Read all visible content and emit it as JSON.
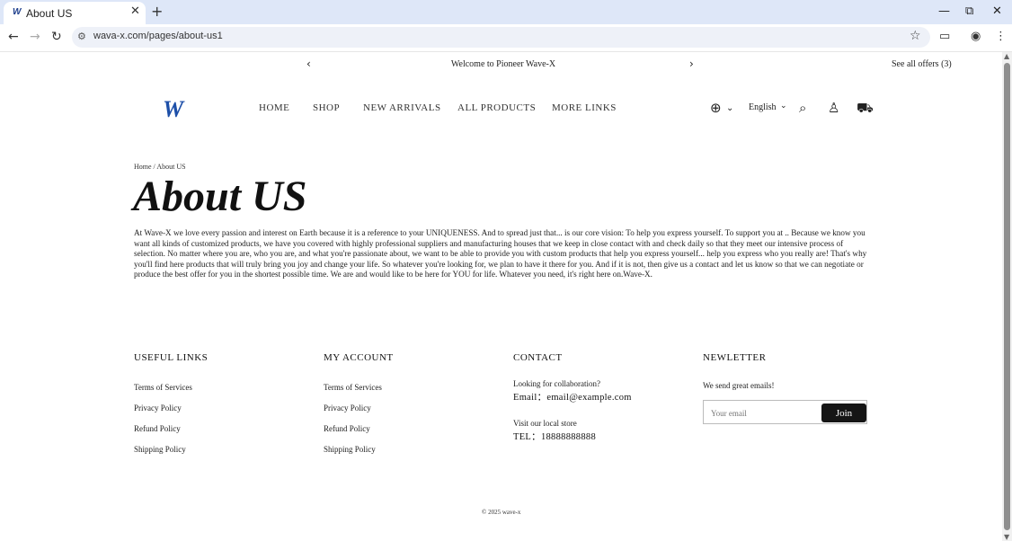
{
  "browser": {
    "tab_title": "About US",
    "tab_logo": "W",
    "url": "wava-x.com/pages/about-us1"
  },
  "announcement": {
    "text": "Welcome to  Pioneer Wave-X",
    "offers": "See all offers (3)"
  },
  "header": {
    "logo": "W",
    "nav": [
      "HOME",
      "SHOP",
      "NEW ARRIVALS",
      "ALL PRODUCTS",
      "MORE LINKS"
    ],
    "language": "English"
  },
  "page": {
    "breadcrumb": "Home / About US",
    "title": "About US",
    "body": "At Wave-X we love every passion and interest on Earth because it is a reference to your UNIQUENESS. And to spread just that... is our core vision: To help you express yourself. To support you at .. Because we know you want all kinds of customized products, we have you covered with highly professional suppliers and manufacturing houses that we keep in close contact with and check daily so that they meet our intensive process of selection. No matter where you are, who you are, and what you're passionate about, we want to be able to provide you with custom products that help you express yourself... help you express who you really are! That's why you'll find here products that will truly bring you joy and change your life. So whatever you're looking for, we plan to have it there for you. And if it is not, then give us a contact and let us know so that we can negotiate or produce the best offer for you in the shortest possible time. We are and would like to be here for YOU for life. Whatever you need, it's right here on.Wave-X."
  },
  "footer": {
    "useful_links": {
      "heading": "USEFUL LINKS",
      "items": [
        "Terms of Services",
        "Privacy Policy",
        "Refund Policy",
        "Shipping Policy"
      ]
    },
    "my_account": {
      "heading": "MY ACCOUNT",
      "items": [
        "Terms of Services",
        "Privacy Policy",
        "Refund Policy",
        "Shipping Policy"
      ]
    },
    "contact": {
      "heading": "CONTACT",
      "collab": "Looking for collaboration?",
      "email": "Email：email@example.com",
      "store": "Visit our local store",
      "tel": "TEL：18888888888"
    },
    "newsletter": {
      "heading": "NEWLETTER",
      "text": "We send great emails!",
      "placeholder": "Your email",
      "button": "Join"
    },
    "copyright": "© 2025 wave-x"
  }
}
